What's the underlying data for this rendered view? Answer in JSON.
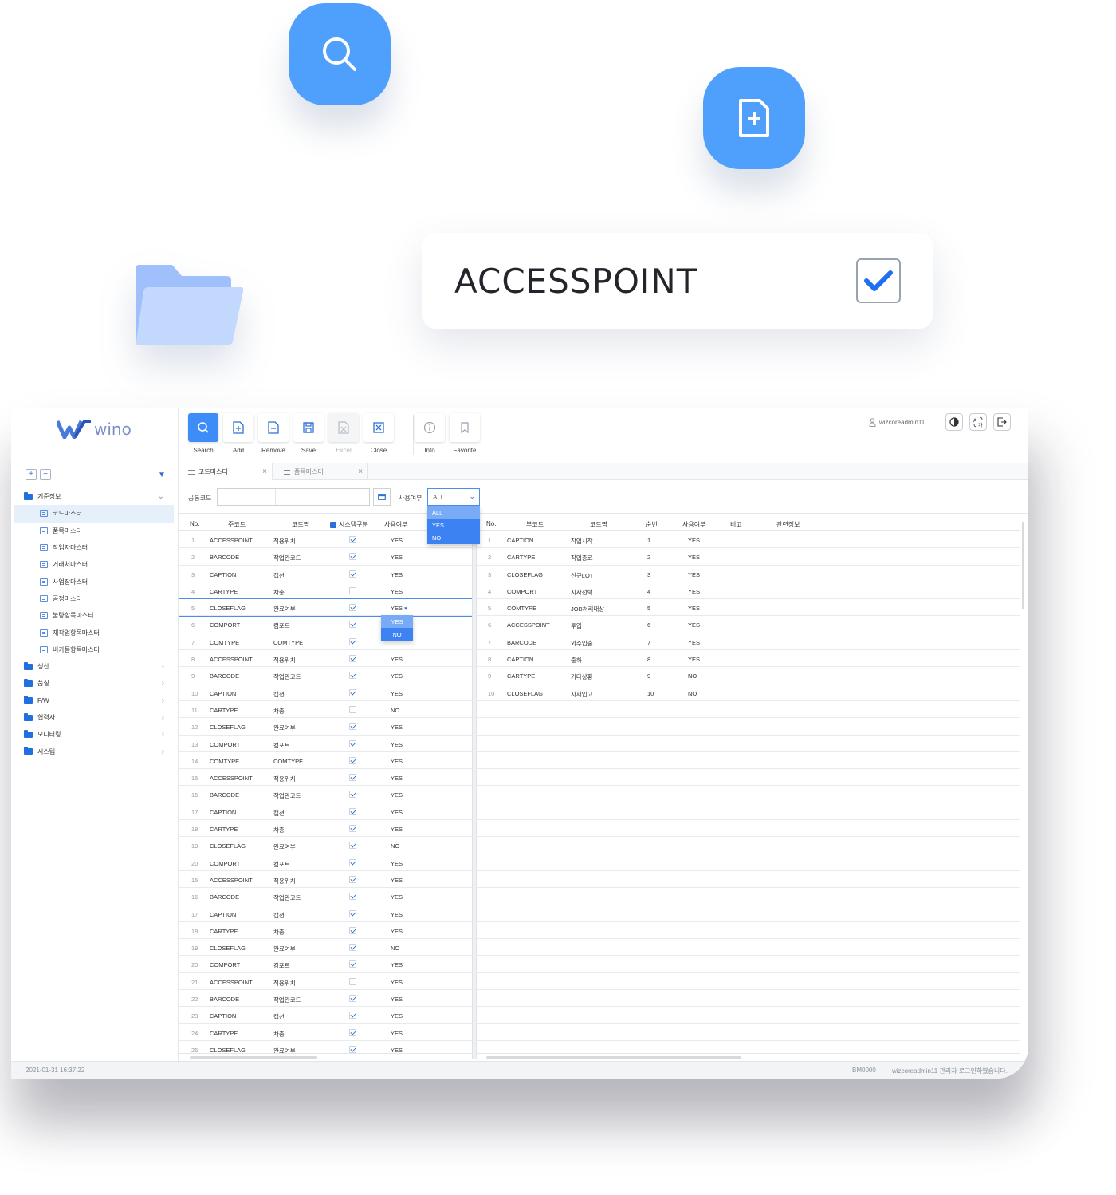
{
  "floating": {
    "search_icon": "search-icon",
    "add_icon": "file-add-icon",
    "folder_icon": "folder-icon",
    "card_label": "ACCESSPOINT",
    "card_checked": true,
    "accent": "#4f9ffd"
  },
  "app": {
    "logo_text": "wino",
    "toolbar": {
      "search": "Search",
      "add": "Add",
      "remove": "Remove",
      "save": "Save",
      "excel": "Excel",
      "close": "Close",
      "info": "Info",
      "favorite": "Favorite"
    },
    "user": "wizcoreadmin11",
    "tabs": [
      "코드마스터",
      "품목마스터"
    ],
    "search": {
      "code_label": "공통코드",
      "use_label": "사용여부",
      "use_value": "ALL",
      "use_options": [
        "ALL",
        "YES",
        "NO"
      ]
    },
    "sidebar": {
      "root": "기준정보",
      "children": [
        "코드마스터",
        "품목마스터",
        "작업자마스터",
        "거래처마스터",
        "사업장마스터",
        "공정마스터",
        "불량항목마스터",
        "재작업항목마스터",
        "비가동항목마스터"
      ],
      "folders": [
        "생산",
        "품질",
        "F/W",
        "협력사",
        "모니터링",
        "시스템"
      ]
    },
    "left_grid": {
      "headers": [
        "No.",
        "주코드",
        "코드명",
        "시스템구분",
        "사용여부"
      ],
      "rows": [
        {
          "no": "1",
          "code": "ACCESSPOINT",
          "name": "적용위치",
          "sys": true,
          "use": "YES"
        },
        {
          "no": "2",
          "code": "BARCODE",
          "name": "작업완코드",
          "sys": true,
          "use": "YES"
        },
        {
          "no": "3",
          "code": "CAPTION",
          "name": "캡션",
          "sys": true,
          "use": "YES"
        },
        {
          "no": "4",
          "code": "CARTYPE",
          "name": "차종",
          "sys": false,
          "use": "YES"
        },
        {
          "no": "5",
          "code": "CLOSEFLAG",
          "name": "완료여부",
          "sys": true,
          "use": "YES"
        },
        {
          "no": "6",
          "code": "COMPORT",
          "name": "컴포트",
          "sys": true,
          "use": ""
        },
        {
          "no": "7",
          "code": "COMTYPE",
          "name": "COMTYPE",
          "sys": true,
          "use": ""
        },
        {
          "no": "8",
          "code": "ACCESSPOINT",
          "name": "적용위치",
          "sys": true,
          "use": "YES"
        },
        {
          "no": "9",
          "code": "BARCODE",
          "name": "작업완코드",
          "sys": true,
          "use": "YES"
        },
        {
          "no": "10",
          "code": "CAPTION",
          "name": "캡션",
          "sys": true,
          "use": "YES"
        },
        {
          "no": "11",
          "code": "CARTYPE",
          "name": "차종",
          "sys": false,
          "use": "NO"
        },
        {
          "no": "12",
          "code": "CLOSEFLAG",
          "name": "완료여부",
          "sys": true,
          "use": "YES"
        },
        {
          "no": "13",
          "code": "COMPORT",
          "name": "컴포트",
          "sys": true,
          "use": "YES"
        },
        {
          "no": "14",
          "code": "COMTYPE",
          "name": "COMTYPE",
          "sys": true,
          "use": "YES"
        },
        {
          "no": "15",
          "code": "ACCESSPOINT",
          "name": "적용위치",
          "sys": true,
          "use": "YES"
        },
        {
          "no": "16",
          "code": "BARCODE",
          "name": "작업완코드",
          "sys": true,
          "use": "YES"
        },
        {
          "no": "17",
          "code": "CAPTION",
          "name": "캡션",
          "sys": true,
          "use": "YES"
        },
        {
          "no": "18",
          "code": "CARTYPE",
          "name": "차종",
          "sys": true,
          "use": "YES"
        },
        {
          "no": "19",
          "code": "CLOSEFLAG",
          "name": "완료여부",
          "sys": true,
          "use": "NO"
        },
        {
          "no": "20",
          "code": "COMPORT",
          "name": "컴포트",
          "sys": true,
          "use": "YES"
        },
        {
          "no": "15",
          "code": "ACCESSPOINT",
          "name": "적용위치",
          "sys": true,
          "use": "YES"
        },
        {
          "no": "16",
          "code": "BARCODE",
          "name": "작업완코드",
          "sys": true,
          "use": "YES"
        },
        {
          "no": "17",
          "code": "CAPTION",
          "name": "캡션",
          "sys": true,
          "use": "YES"
        },
        {
          "no": "18",
          "code": "CARTYPE",
          "name": "차종",
          "sys": true,
          "use": "YES"
        },
        {
          "no": "19",
          "code": "CLOSEFLAG",
          "name": "완료여부",
          "sys": true,
          "use": "NO"
        },
        {
          "no": "20",
          "code": "COMPORT",
          "name": "컴포트",
          "sys": true,
          "use": "YES"
        },
        {
          "no": "21",
          "code": "ACCESSPOINT",
          "name": "적용위치",
          "sys": false,
          "use": "YES"
        },
        {
          "no": "22",
          "code": "BARCODE",
          "name": "작업완코드",
          "sys": true,
          "use": "YES"
        },
        {
          "no": "23",
          "code": "CAPTION",
          "name": "캡션",
          "sys": true,
          "use": "YES"
        },
        {
          "no": "24",
          "code": "CARTYPE",
          "name": "차종",
          "sys": true,
          "use": "YES"
        },
        {
          "no": "25",
          "code": "CLOSEFLAG",
          "name": "완료여부",
          "sys": true,
          "use": "YES"
        }
      ],
      "editing_row_value": "YES",
      "editing_options": [
        "YES",
        "NO"
      ]
    },
    "right_grid": {
      "headers": [
        "No.",
        "부코드",
        "코드명",
        "순번",
        "사용여부",
        "비고",
        "관련정보"
      ],
      "rows": [
        {
          "no": "1",
          "code": "CAPTION",
          "name": "작업시작",
          "seq": "1",
          "use": "YES"
        },
        {
          "no": "2",
          "code": "CARTYPE",
          "name": "작업종료",
          "seq": "2",
          "use": "YES"
        },
        {
          "no": "3",
          "code": "CLOSEFLAG",
          "name": "신규LOT",
          "seq": "3",
          "use": "YES"
        },
        {
          "no": "4",
          "code": "COMPORT",
          "name": "지사선택",
          "seq": "4",
          "use": "YES"
        },
        {
          "no": "5",
          "code": "COMTYPE",
          "name": "JOB처리대상",
          "seq": "5",
          "use": "YES"
        },
        {
          "no": "6",
          "code": "ACCESSPOINT",
          "name": "투입",
          "seq": "6",
          "use": "YES"
        },
        {
          "no": "7",
          "code": "BARCODE",
          "name": "외주입출",
          "seq": "7",
          "use": "YES"
        },
        {
          "no": "8",
          "code": "CAPTION",
          "name": "출하",
          "seq": "8",
          "use": "YES"
        },
        {
          "no": "9",
          "code": "CARTYPE",
          "name": "기타상황",
          "seq": "9",
          "use": "NO"
        },
        {
          "no": "10",
          "code": "CLOSEFLAG",
          "name": "자재입고",
          "seq": "10",
          "use": "NO"
        }
      ]
    },
    "status": {
      "datetime": "2021-01-31 16:37:22",
      "screen_id": "BM0000",
      "message": "wizcoreadmin11 관리자 로그인하였습니다."
    }
  }
}
